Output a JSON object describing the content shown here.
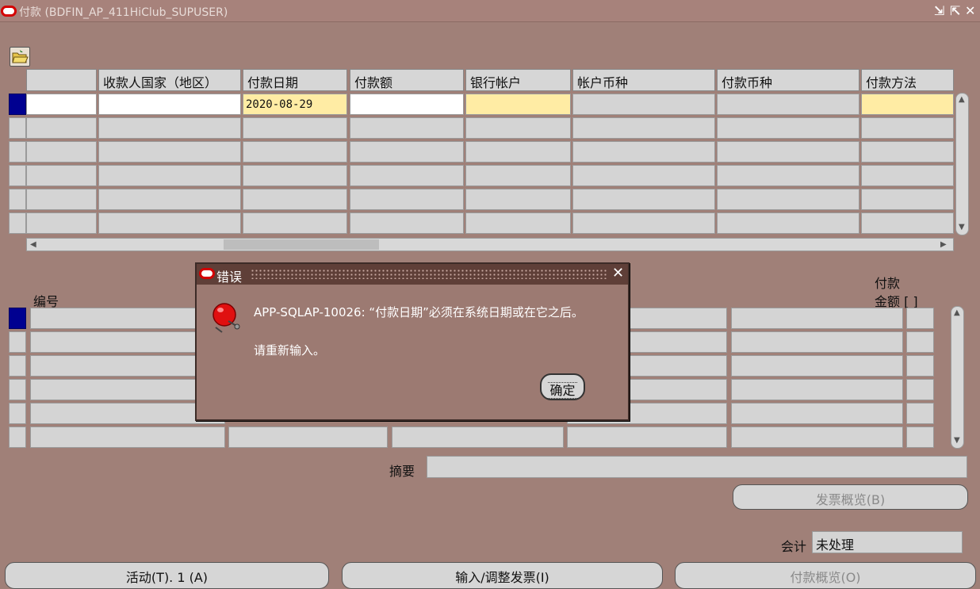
{
  "window": {
    "title": "付款 (BDFIN_AP_411HiClub_SUPUSER)",
    "controls": [
      "minimize-icon",
      "maximize-icon",
      "close-icon"
    ]
  },
  "payments_table": {
    "headers": [
      "",
      "收款人国家（地区）",
      "付款日期",
      "付款额",
      "银行帐户",
      "帐户币种",
      "付款币种",
      "付款方法"
    ],
    "first_row": {
      "payment_date": "2020-08-29"
    }
  },
  "invoice_section": {
    "number_label": "编号",
    "amount_label_line1": "付款",
    "amount_label_line2": "金额 [ ]"
  },
  "summary_label": "摘要",
  "invoice_overview_button": "发票概览(B)",
  "accounting": {
    "label": "会计",
    "value": "未处理"
  },
  "bottom_buttons": {
    "actions": "活动(T). 1 (A)",
    "enter_invoices": "输入/调整发票(I)",
    "payment_overview": "付款概览(O)"
  },
  "error_dialog": {
    "title": "错误",
    "message": "APP-SQLAP-10026: “付款日期”必须在系统日期或在它之后。",
    "instruction": "请重新输入。",
    "ok_button": "确定"
  },
  "colors": {
    "background": "#a08078",
    "required_field": "#ffeca4",
    "dialog_title": "#5f3f38",
    "active_record": "#000090"
  }
}
